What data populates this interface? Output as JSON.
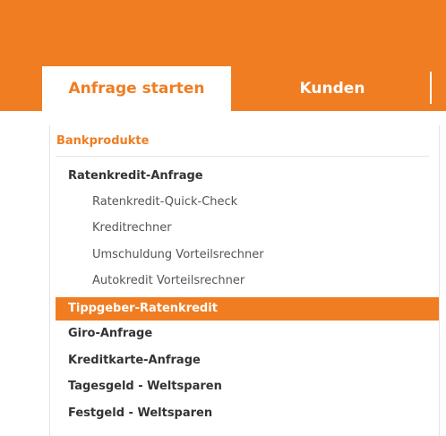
{
  "nav": {
    "tabs": [
      {
        "label": "Anfrage starten",
        "active": true
      },
      {
        "label": "Kunden",
        "active": false
      }
    ]
  },
  "menu": {
    "section_title": "Bankprodukte",
    "items": [
      {
        "label": "Ratenkredit-Anfrage",
        "level": 1
      },
      {
        "label": "Ratenkredit-Quick-Check",
        "level": 2
      },
      {
        "label": "Kreditrechner",
        "level": 2
      },
      {
        "label": "Umschuldung Vorteilsrechner",
        "level": 2
      },
      {
        "label": "Autokredit Vorteilsrechner",
        "level": 2
      },
      {
        "label": "Tippgeber-Ratenkredit",
        "level": 1,
        "selected": true
      },
      {
        "label": "Giro-Anfrage",
        "level": 1
      },
      {
        "label": "Kreditkarte-Anfrage",
        "level": 1
      },
      {
        "label": "Tagesgeld - Weltsparen",
        "level": 1
      },
      {
        "label": "Festgeld - Weltsparen",
        "level": 1
      }
    ]
  },
  "colors": {
    "accent": "#f07d22",
    "text": "#333333",
    "background": "#ffffff"
  }
}
